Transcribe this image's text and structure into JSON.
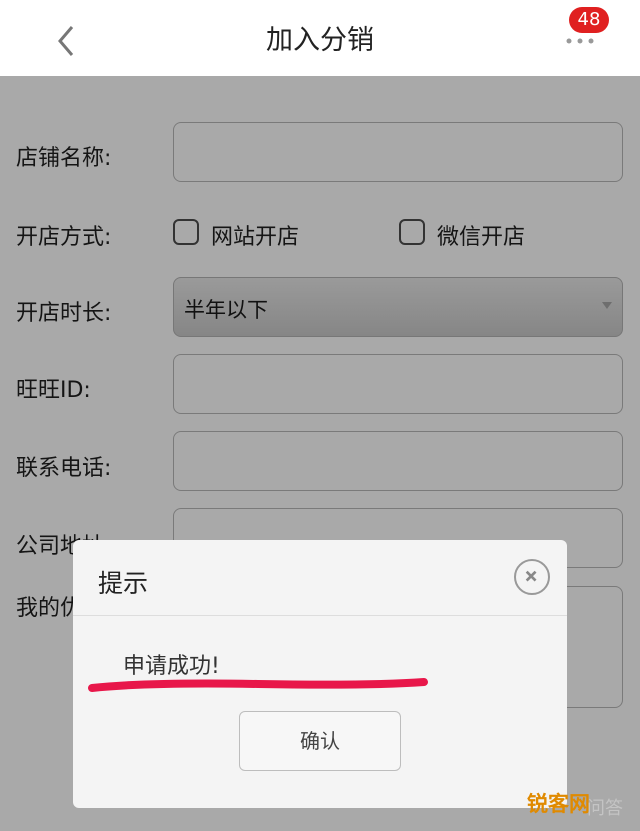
{
  "header": {
    "title": "加入分销",
    "notification_count": "48",
    "back_icon": "chevron-left-icon",
    "more_icon": "more-dots-icon"
  },
  "form": {
    "shop_name_label": "店铺名称:",
    "shop_name_value": "",
    "open_method_label": "开店方式:",
    "open_method_options": [
      "网站开店",
      "微信开店"
    ],
    "duration_label": "开店时长:",
    "duration_selected": "半年以下",
    "wangwang_label": "旺旺ID:",
    "wangwang_value": "",
    "phone_label": "联系电话:",
    "phone_value": "",
    "address_label": "公司地址:",
    "address_value": "",
    "partial_label": "我的优"
  },
  "dialog": {
    "title": "提示",
    "message": "申请成功!",
    "confirm_label": "确认",
    "close_icon": "close-circle-icon",
    "highlight_color": "#e8174a"
  },
  "watermark": {
    "brand": "锐客网",
    "text": "问答"
  }
}
